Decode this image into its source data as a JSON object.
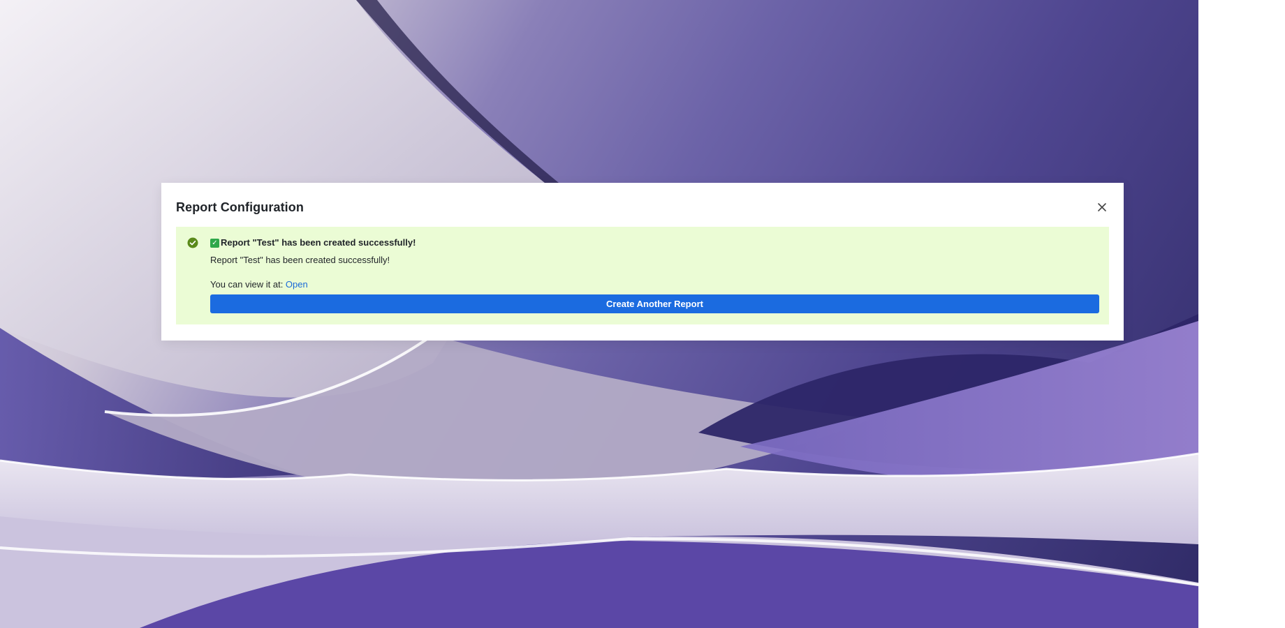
{
  "modal": {
    "title": "Report Configuration",
    "close_icon": "close-icon"
  },
  "alert": {
    "status_icon": "check-circle-icon",
    "title_emoji": "✓",
    "title": "Report \"Test\" has been created successfully!",
    "message": "Report \"Test\" has been created successfully!",
    "view_prefix": "You can view it at: ",
    "view_link": "Open",
    "button_label": "Create Another Report"
  },
  "colors": {
    "alert_bg": "#ebfcd5",
    "primary_button": "#1b6be0",
    "link": "#1a6ad8",
    "success_icon": "#5a8a1a"
  }
}
